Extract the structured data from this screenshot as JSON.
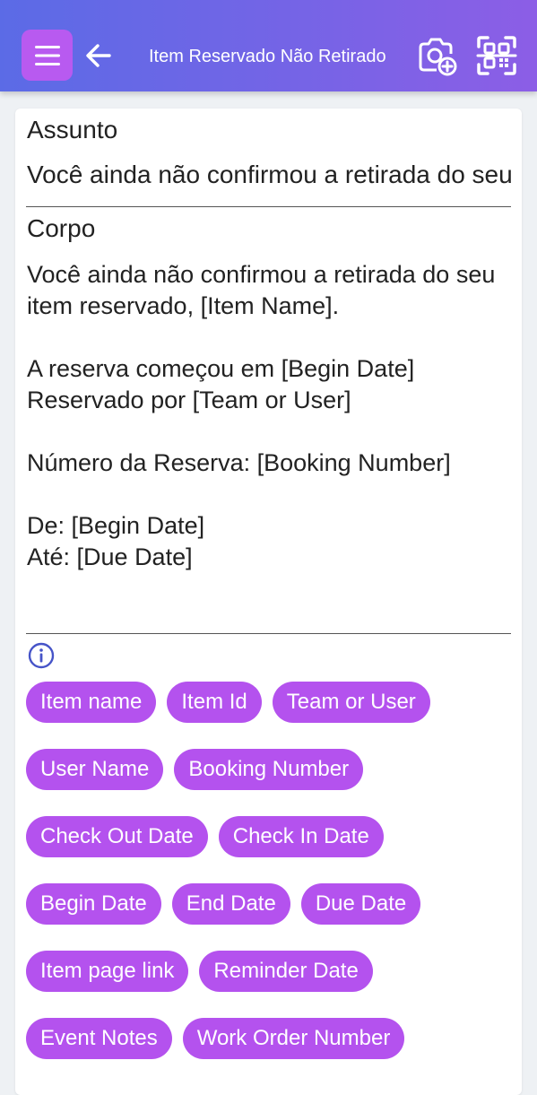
{
  "header": {
    "title": "Item Reservado Não Retirado",
    "menu_icon": "hamburger-menu-icon",
    "back_icon": "arrow-left-icon",
    "camera_icon": "camera-add-icon",
    "scan_icon": "qr-scan-icon",
    "gradient_start": "#5b6be6",
    "gradient_end": "#8c5ee6",
    "menu_button_color": "#b85af0"
  },
  "subject": {
    "label": "Assunto",
    "value": "Você ainda não confirmou a retirada do seu item reservado"
  },
  "body": {
    "label": "Corpo",
    "value": "Você ainda não confirmou a retirada do seu item reservado, [Item Name].\n\nA reserva começou em [Begin Date]\nReservado por [Team or User]\n\nNúmero da Reserva: [Booking Number]\n\nDe: [Begin Date]\nAté: [Due Date]"
  },
  "info_icon": "info-circle-icon",
  "chip_color": "#b452ee",
  "chip_rows": [
    [
      "Item name",
      "Item Id",
      "Team or User"
    ],
    [
      "User Name",
      "Booking Number"
    ],
    [
      "Check Out Date",
      "Check In Date"
    ],
    [
      "Begin Date",
      "End Date",
      "Due Date"
    ],
    [
      "Item page link",
      "Reminder Date"
    ],
    [
      "Event Notes",
      "Work Order Number"
    ]
  ]
}
